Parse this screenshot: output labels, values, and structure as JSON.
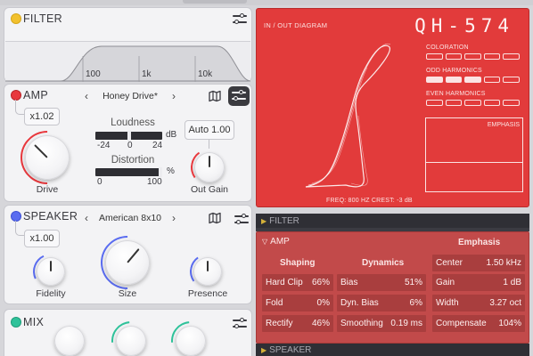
{
  "filter": {
    "title": "FILTER",
    "led_color": "#f2c12e",
    "ticks": [
      "100",
      "1k",
      "10k"
    ]
  },
  "amp": {
    "title": "AMP",
    "led_color": "#e8383d",
    "gain_value": "x1.02",
    "preset": "Honey Drive*",
    "prev": "‹",
    "next": "›",
    "loudness_label": "Loudness",
    "loudness_unit": "dB",
    "loudness_ticks": [
      "-24",
      "0",
      "24"
    ],
    "distortion_label": "Distortion",
    "distortion_unit": "%",
    "distortion_ticks": [
      "0",
      "100"
    ],
    "auto_label": "Auto 1.00",
    "drive_label": "Drive",
    "outgain_label": "Out Gain"
  },
  "speaker": {
    "title": "SPEAKER",
    "led_color": "#5a6cf0",
    "gain_value": "x1.00",
    "preset": "American 8x10",
    "prev": "‹",
    "next": "›",
    "fidelity_label": "Fidelity",
    "size_label": "Size",
    "presence_label": "Presence"
  },
  "mix": {
    "title": "MIX",
    "led_color": "#2fc29a"
  },
  "display": {
    "diagram_title": "IN / OUT DIAGRAM",
    "model": "QH-574",
    "coloration_label": "COLORATION",
    "coloration_level": 0,
    "odd_label": "ODD HARMONICS",
    "odd_level": 3,
    "even_label": "EVEN HARMONICS",
    "even_level": 0,
    "emphasis_label": "EMPHASIS",
    "readout": "FREQ: 800 HZ   CREST: -3 dB",
    "bg_color": "#e23b3b"
  },
  "strips": {
    "filter": "FILTER",
    "speaker": "SPEAKER"
  },
  "amp_detail": {
    "title": "AMP",
    "shaping_header": "Shaping",
    "dynamics_header": "Dynamics",
    "emphasis_header": "Emphasis",
    "shaping": [
      {
        "name": "Hard Clip",
        "value": "66%"
      },
      {
        "name": "Fold",
        "value": "0%"
      },
      {
        "name": "Rectify",
        "value": "46%"
      }
    ],
    "dynamics": [
      {
        "name": "Bias",
        "value": "51%"
      },
      {
        "name": "Dyn. Bias",
        "value": "6%"
      },
      {
        "name": "Smoothing",
        "value": "0.19 ms"
      }
    ],
    "emphasis": [
      {
        "name": "Center",
        "value": "1.50 kHz"
      },
      {
        "name": "Gain",
        "value": "1 dB"
      },
      {
        "name": "Width",
        "value": "3.27 oct"
      },
      {
        "name": "Compensate",
        "value": "104%"
      }
    ]
  }
}
